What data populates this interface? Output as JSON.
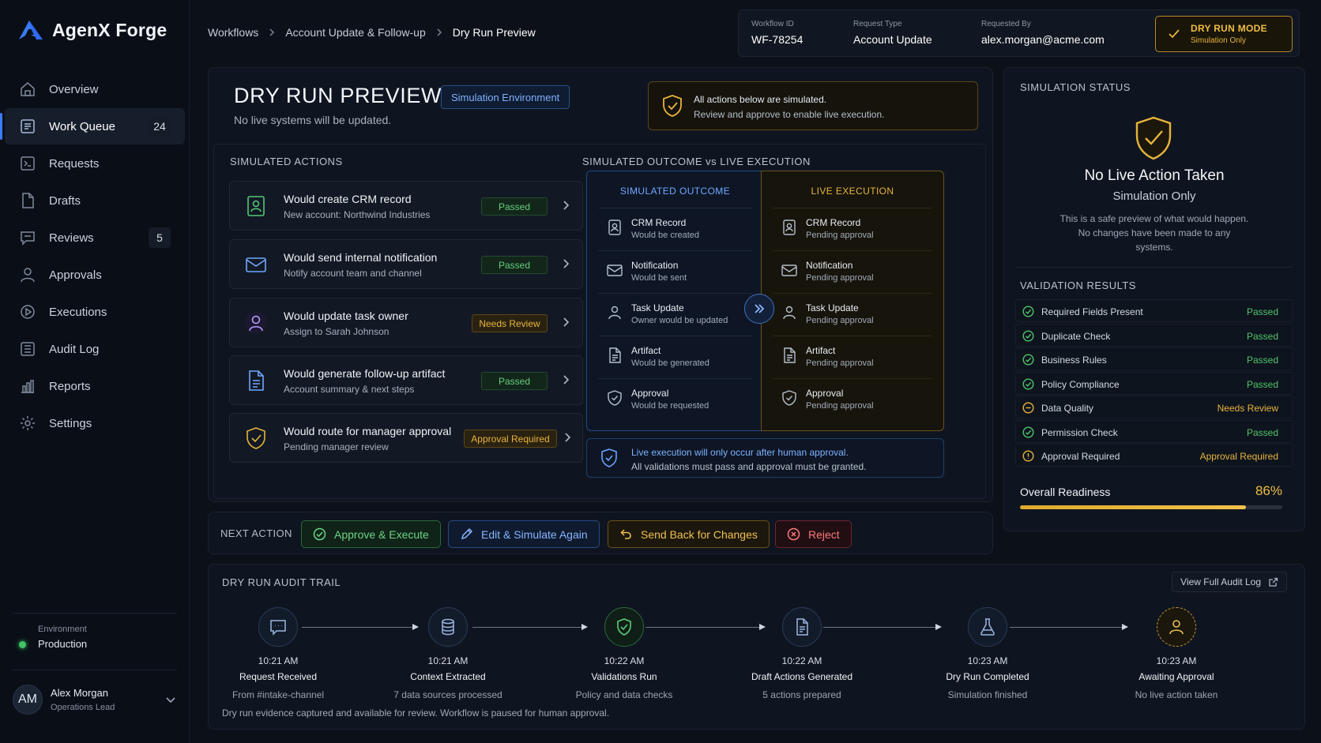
{
  "app": {
    "name": "AgenX Forge"
  },
  "colors": {
    "accent_blue": "#3a7bff",
    "pass_green": "#4fc46a",
    "warn_amber": "#e7b43b",
    "reject_red": "#ff7a7a"
  },
  "sidebar": {
    "items": [
      {
        "label": "Overview",
        "icon": "home-icon"
      },
      {
        "label": "Work Queue",
        "icon": "queue-icon",
        "count": "24",
        "active": true
      },
      {
        "label": "Requests",
        "icon": "inbox-icon"
      },
      {
        "label": "Drafts",
        "icon": "document-icon"
      },
      {
        "label": "Reviews",
        "icon": "chat-icon",
        "count": "5"
      },
      {
        "label": "Approvals",
        "icon": "user-check-icon"
      },
      {
        "label": "Executions",
        "icon": "play-circle-icon"
      },
      {
        "label": "Audit Log",
        "icon": "log-icon"
      },
      {
        "label": "Reports",
        "icon": "bar-chart-icon"
      },
      {
        "label": "Settings",
        "icon": "gear-icon"
      }
    ],
    "environment": {
      "label": "Environment",
      "value": "Production"
    },
    "user": {
      "initials": "AM",
      "name": "Alex Morgan",
      "role": "Operations Lead"
    }
  },
  "breadcrumb": [
    "Workflows",
    "Account Update & Follow-up",
    "Dry Run Preview"
  ],
  "meta": {
    "workflow_id": {
      "label": "Workflow ID",
      "value": "WF-78254"
    },
    "request_type": {
      "label": "Request Type",
      "value": "Account Update"
    },
    "requested_by": {
      "label": "Requested By",
      "value": "alex.morgan@acme.com"
    },
    "mode": {
      "title": "DRY RUN MODE",
      "sub": "Simulation Only"
    }
  },
  "header": {
    "title": "DRY RUN PREVIEW",
    "env_chip": "Simulation Environment",
    "subtitle": "No live systems will be updated.",
    "notice_l1": "All actions below are simulated.",
    "notice_l2": "Review and approve to enable live execution."
  },
  "simulated_actions": {
    "title": "SIMULATED ACTIONS",
    "items": [
      {
        "title": "Would create CRM record",
        "sub": "New account: Northwind Industries",
        "status": "Passed",
        "icon": "contact-card-icon"
      },
      {
        "title": "Would send internal notification",
        "sub": "Notify account team and channel",
        "status": "Passed",
        "icon": "mail-icon"
      },
      {
        "title": "Would update task owner",
        "sub": "Assign to Sarah Johnson",
        "status": "Needs Review",
        "icon": "user-icon"
      },
      {
        "title": "Would generate follow-up artifact",
        "sub": "Account summary & next steps",
        "status": "Passed",
        "icon": "document-icon"
      },
      {
        "title": "Would route for manager approval",
        "sub": "Pending manager review",
        "status": "Approval Required",
        "icon": "shield-check-icon"
      }
    ]
  },
  "comparison": {
    "title": "SIMULATED OUTCOME vs LIVE EXECUTION",
    "simulated_head": "SIMULATED OUTCOME",
    "live_head": "LIVE EXECUTION",
    "rows": [
      {
        "title": "CRM Record",
        "sim": "Would be created",
        "live": "Pending approval",
        "icon": "contact-card-icon"
      },
      {
        "title": "Notification",
        "sim": "Would be sent",
        "live": "Pending approval",
        "icon": "mail-icon"
      },
      {
        "title": "Task Update",
        "sim": "Owner would be updated",
        "live": "Pending approval",
        "icon": "user-icon"
      },
      {
        "title": "Artifact",
        "sim": "Would be generated",
        "live": "Pending approval",
        "icon": "document-icon"
      },
      {
        "title": "Approval",
        "sim": "Would be requested",
        "live": "Pending approval",
        "icon": "shield-check-icon"
      }
    ],
    "note_l1": "Live execution will only occur after human approval.",
    "note_l2": "All validations must pass and approval must be granted."
  },
  "status": {
    "title": "SIMULATION STATUS",
    "headline": "No Live Action Taken",
    "sub": "Simulation Only",
    "desc": "This is a safe preview of what would happen. No changes have been made to any systems.",
    "validation_title": "VALIDATION RESULTS",
    "validations": [
      {
        "label": "Required Fields Present",
        "status": "Passed",
        "kind": "pass"
      },
      {
        "label": "Duplicate Check",
        "status": "Passed",
        "kind": "pass"
      },
      {
        "label": "Business Rules",
        "status": "Passed",
        "kind": "pass"
      },
      {
        "label": "Policy Compliance",
        "status": "Passed",
        "kind": "pass"
      },
      {
        "label": "Data Quality",
        "status": "Needs Review",
        "kind": "review"
      },
      {
        "label": "Permission Check",
        "status": "Passed",
        "kind": "pass"
      },
      {
        "label": "Approval Required",
        "status": "Approval Required",
        "kind": "alert"
      }
    ],
    "readiness_label": "Overall Readiness",
    "readiness_text": "86%",
    "readiness_value": 0.86
  },
  "next_action": {
    "label": "NEXT ACTION",
    "approve": "Approve & Execute",
    "edit": "Edit & Simulate Again",
    "send_back": "Send Back for Changes",
    "reject": "Reject"
  },
  "audit": {
    "title": "DRY RUN AUDIT TRAIL",
    "link": "View Full Audit Log",
    "steps": [
      {
        "time": "10:21 AM",
        "title": "Request Received",
        "sub": "From #intake-channel",
        "icon": "message-icon"
      },
      {
        "time": "10:21 AM",
        "title": "Context Extracted",
        "sub": "7 data sources processed",
        "icon": "database-icon"
      },
      {
        "time": "10:22 AM",
        "title": "Validations Run",
        "sub": "Policy and data checks",
        "icon": "shield-check-icon"
      },
      {
        "time": "10:22 AM",
        "title": "Draft Actions Generated",
        "sub": "5 actions prepared",
        "icon": "document-icon"
      },
      {
        "time": "10:23 AM",
        "title": "Dry Run Completed",
        "sub": "Simulation finished",
        "icon": "flask-icon"
      },
      {
        "time": "10:23 AM",
        "title": "Awaiting Approval",
        "sub": "No live action taken",
        "icon": "user-icon"
      }
    ],
    "footer": "Dry run evidence captured and available for review. Workflow is paused for human approval."
  }
}
